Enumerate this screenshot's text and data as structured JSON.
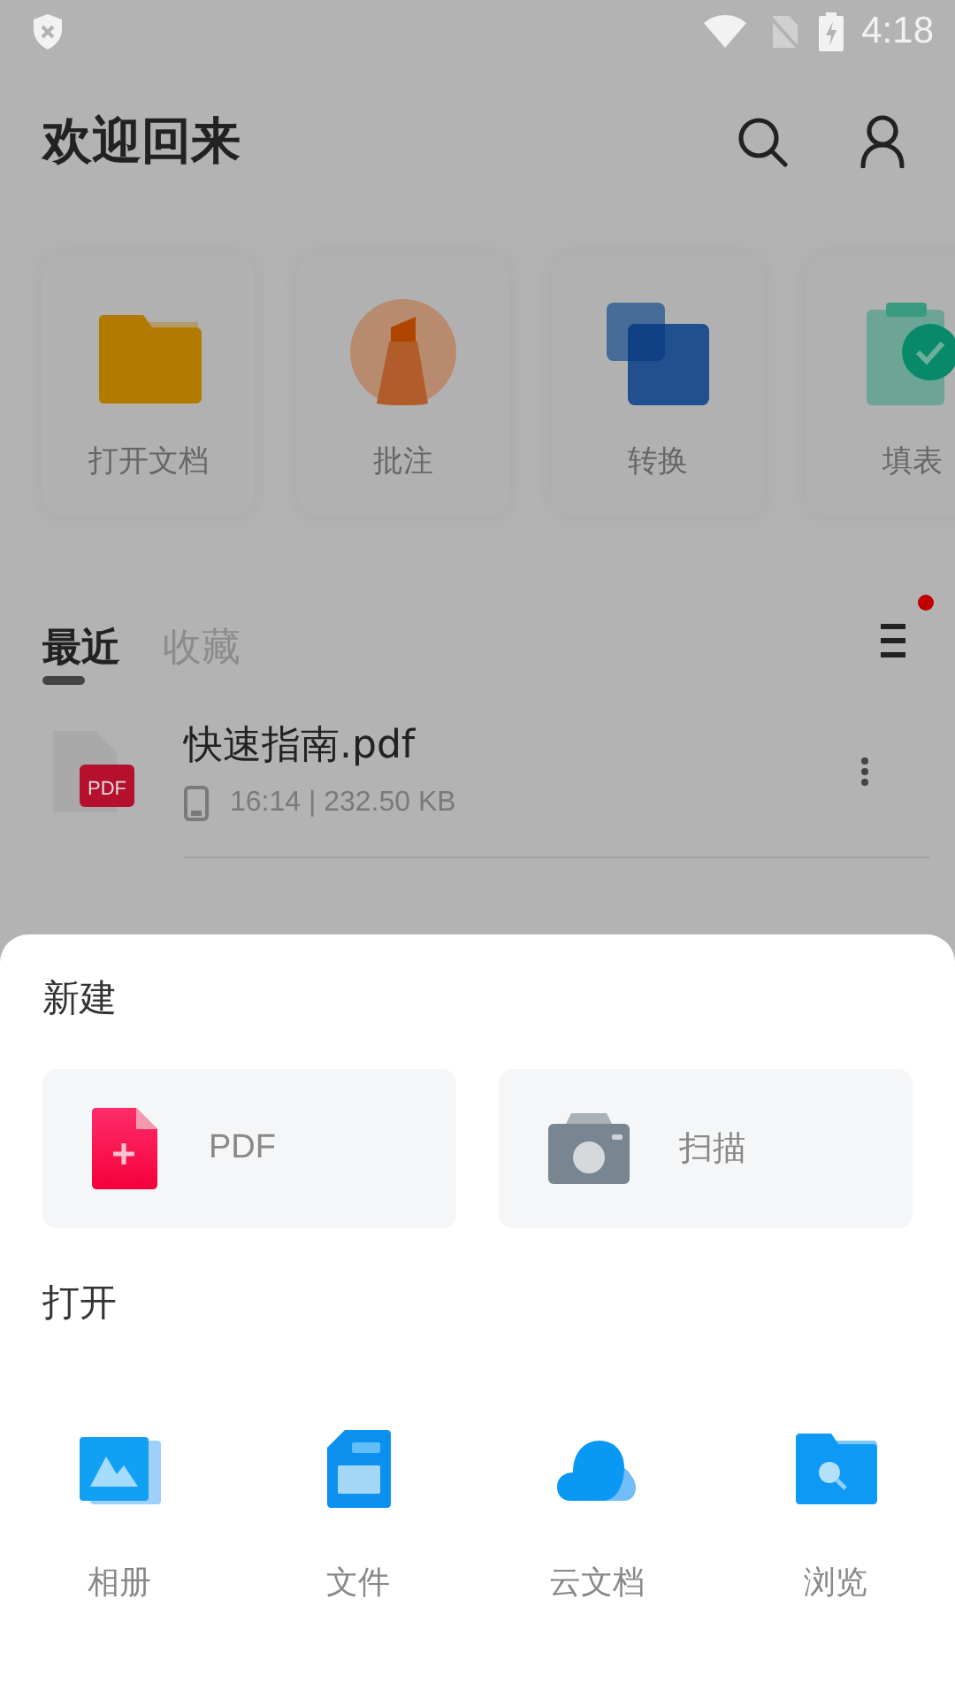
{
  "status_bar": {
    "time": "4:18"
  },
  "header": {
    "title": "欢迎回来"
  },
  "quick_actions": [
    {
      "label": "打开文档",
      "kind": "folder"
    },
    {
      "label": "批注",
      "kind": "annotate"
    },
    {
      "label": "转换",
      "kind": "convert"
    },
    {
      "label": "填表",
      "kind": "form"
    }
  ],
  "tabs": [
    {
      "label": "最近",
      "selected": true
    },
    {
      "label": "收藏",
      "selected": false
    }
  ],
  "sort_button": {
    "notification": true
  },
  "files": [
    {
      "name": "快速指南.pdf",
      "meta": "16:14 | 232.50 KB",
      "badge": "PDF"
    }
  ],
  "sheet": {
    "new_section": {
      "title": "新建",
      "items": [
        {
          "label": "PDF",
          "kind": "pdf"
        },
        {
          "label": "扫描",
          "kind": "scan"
        }
      ]
    },
    "open_section": {
      "title": "打开",
      "items": [
        {
          "label": "相册",
          "kind": "album"
        },
        {
          "label": "文件",
          "kind": "file"
        },
        {
          "label": "云文档",
          "kind": "cloud"
        },
        {
          "label": "浏览",
          "kind": "browse"
        }
      ]
    }
  }
}
